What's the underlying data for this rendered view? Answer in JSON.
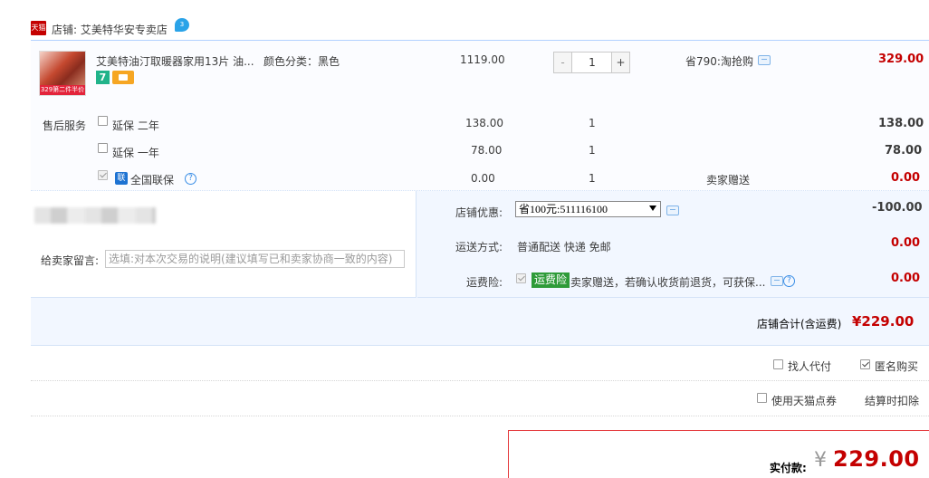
{
  "shop": {
    "logo_text": "天猫",
    "name": "店铺: 艾美特华安专卖店",
    "ww_badge": "3"
  },
  "item": {
    "thumb_label": "329第二件半价",
    "title": "艾美特油汀取暖器家用13片 油...",
    "spec": "颜色分类：黑色",
    "unit_price": "1119.00",
    "quantity": "1",
    "qty_minus": "-",
    "qty_plus": "+",
    "discount": "省790:淘抢购",
    "subtotal": "329.00",
    "badge_seven": "7"
  },
  "service": {
    "label": "售后服务",
    "rows": [
      {
        "name": "延保 二年",
        "price": "138.00",
        "qty": "1",
        "note": "",
        "amount": "138.00",
        "checked": false
      },
      {
        "name": "延保 一年",
        "price": "78.00",
        "qty": "1",
        "note": "",
        "amount": "78.00",
        "checked": false
      },
      {
        "name": "全国联保",
        "price": "0.00",
        "qty": "1",
        "note": "卖家赠送",
        "amount": "0.00",
        "checked": true
      }
    ],
    "lianbao_icon": "联",
    "help_glyph": "?"
  },
  "message": {
    "label": "给卖家留言:",
    "placeholder": "选填:对本次交易的说明(建议填写已和卖家协商一致的内容)"
  },
  "promo": {
    "label": "店铺优惠:",
    "selected": "省100元:511116100",
    "amount": "-100.00"
  },
  "shipping": {
    "label": "运送方式:",
    "value": "普通配送 快递 免邮",
    "amount": "0.00"
  },
  "insurance": {
    "label": "运费险:",
    "badge": "运费险",
    "text": "卖家赠送，若确认收货前退货，可获保...",
    "amount": "0.00"
  },
  "total": {
    "label": "店铺合计(含运费)",
    "amount": "¥229.00"
  },
  "options": {
    "proxy_pay": "找人代付",
    "anonymous": "匿名购买",
    "coupon": "使用天猫点券",
    "deduct_note": "结算时扣除"
  },
  "payment": {
    "label": "实付款:",
    "currency": "¥",
    "amount": "229.00"
  }
}
